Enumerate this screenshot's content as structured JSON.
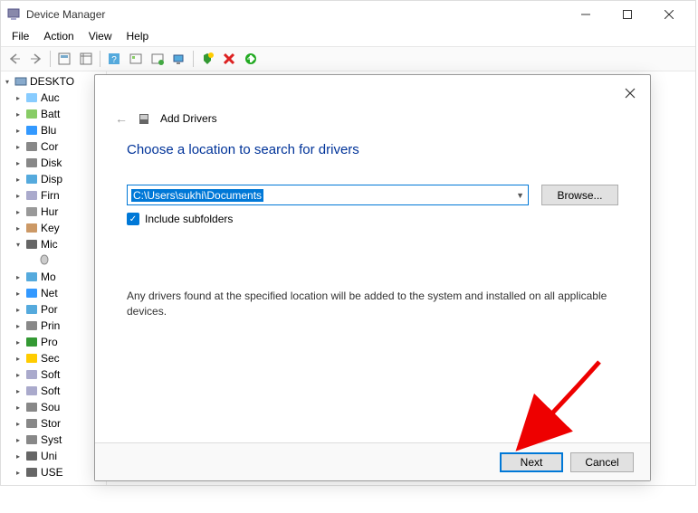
{
  "window": {
    "title": "Device Manager",
    "menu": [
      "File",
      "Action",
      "View",
      "Help"
    ]
  },
  "tree": {
    "root": "DESKTO",
    "items": [
      {
        "label": "Auc",
        "exp": ">"
      },
      {
        "label": "Batt",
        "exp": ">"
      },
      {
        "label": "Blu",
        "exp": ">"
      },
      {
        "label": "Cor",
        "exp": ">"
      },
      {
        "label": "Disk",
        "exp": ">"
      },
      {
        "label": "Disp",
        "exp": ">"
      },
      {
        "label": "Firn",
        "exp": ">"
      },
      {
        "label": "Hur",
        "exp": ">"
      },
      {
        "label": "Key",
        "exp": ">"
      },
      {
        "label": "Mic",
        "exp": "v",
        "child": true
      },
      {
        "label": "Mo",
        "exp": ">"
      },
      {
        "label": "Net",
        "exp": ">"
      },
      {
        "label": "Por",
        "exp": ">"
      },
      {
        "label": "Prin",
        "exp": ">"
      },
      {
        "label": "Pro",
        "exp": ">"
      },
      {
        "label": "Sec",
        "exp": ">"
      },
      {
        "label": "Soft",
        "exp": ">"
      },
      {
        "label": "Soft",
        "exp": ">"
      },
      {
        "label": "Sou",
        "exp": ">"
      },
      {
        "label": "Stor",
        "exp": ">"
      },
      {
        "label": "Syst",
        "exp": ">"
      },
      {
        "label": "Uni",
        "exp": ">"
      },
      {
        "label": "USE",
        "exp": ">"
      }
    ]
  },
  "dialog": {
    "title": "Add Drivers",
    "heading": "Choose a location to search for drivers",
    "path": "C:\\Users\\sukhi\\Documents",
    "browse": "Browse...",
    "include_subfolders": "Include subfolders",
    "description": "Any drivers found at the specified location will be added to the system and installed on all applicable devices.",
    "next": "Next",
    "cancel": "Cancel"
  }
}
